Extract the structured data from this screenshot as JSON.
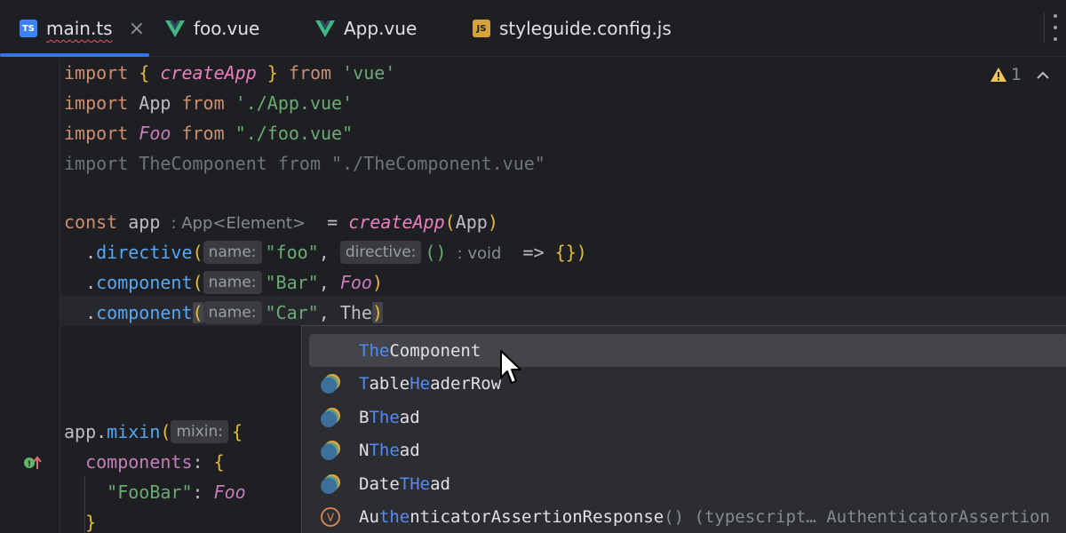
{
  "tabs": [
    {
      "label": "main.ts",
      "icon": "ts-file-icon",
      "badge": "TS",
      "active": true
    },
    {
      "label": "foo.vue",
      "icon": "vue-file-icon",
      "active": false
    },
    {
      "label": "App.vue",
      "icon": "vue-file-icon",
      "active": false
    },
    {
      "label": "styleguide.config.js",
      "icon": "js-file-icon",
      "badge": "JS",
      "active": false
    }
  ],
  "tab_close_glyph": "×",
  "inspection": {
    "warning_count": "1",
    "icon": "warning-triangle-icon"
  },
  "code": {
    "l1": {
      "kw1": "import",
      "b1": "{ ",
      "fn": "createApp",
      "b2": " }",
      "kw2": "from",
      "str": "'vue'"
    },
    "l2": {
      "kw1": "import",
      "id": "App",
      "kw2": "from",
      "str": "'./App.vue'"
    },
    "l3": {
      "kw1": "import",
      "id": "Foo",
      "kw2": "from",
      "str": "\"./foo.vue\""
    },
    "l4": {
      "text": "import TheComponent from \"./TheComponent.vue\""
    },
    "l6": {
      "kw": "const",
      "id": "app",
      "hint": ": App<Element>",
      "eq": "=",
      "fn": "createApp",
      "arg": "App"
    },
    "l7": {
      "method": "directive",
      "hint1": "name:",
      "str": "\"foo\"",
      "comma": ",",
      "hint2": "directive:",
      "parens": "()",
      "hint3": ": void",
      "arrow": "=>",
      "body": "{}"
    },
    "l8": {
      "method": "component",
      "hint1": "name:",
      "str": "\"Bar\"",
      "comma": ",",
      "arg": "Foo"
    },
    "l9": {
      "method": "component",
      "hint1": "name:",
      "str": "\"Car\"",
      "comma": ",",
      "arg": "The"
    },
    "l13": {
      "obj": "app",
      "method": "mixin",
      "hint1": "mixin:",
      "brace": "{"
    },
    "l14": {
      "prop": "components",
      "colon": ":",
      "brace": "{"
    },
    "l15": {
      "key": "\"FooBar\"",
      "colon": ":",
      "val": "Foo"
    },
    "l16": {
      "brace": "}"
    }
  },
  "completion": {
    "items": [
      {
        "match": "The",
        "rest": "Component",
        "tail": "",
        "icon": "none",
        "selected": true
      },
      {
        "m1": "T",
        "r1": "able",
        "m2": "He",
        "r2": "aderRow",
        "icon": "vue-component-icon"
      },
      {
        "pre": "B",
        "match": "The",
        "rest": "ad",
        "icon": "vue-component-icon"
      },
      {
        "pre": "N",
        "match": "The",
        "rest": "ad",
        "icon": "vue-component-icon"
      },
      {
        "pre": "Date",
        "match": "THe",
        "rest": "ad",
        "icon": "vue-component-icon"
      },
      {
        "pre": "Au",
        "match": "the",
        "rest": "nticatorAssertionResponse",
        "tail": "() (typescript… AuthenticatorAssertion",
        "icon": "variable-icon",
        "badge": "V"
      }
    ]
  },
  "colors": {
    "accent": "#3574f0",
    "match": "#548af7",
    "background": "#1e1f22",
    "popup": "#2b2d30"
  }
}
